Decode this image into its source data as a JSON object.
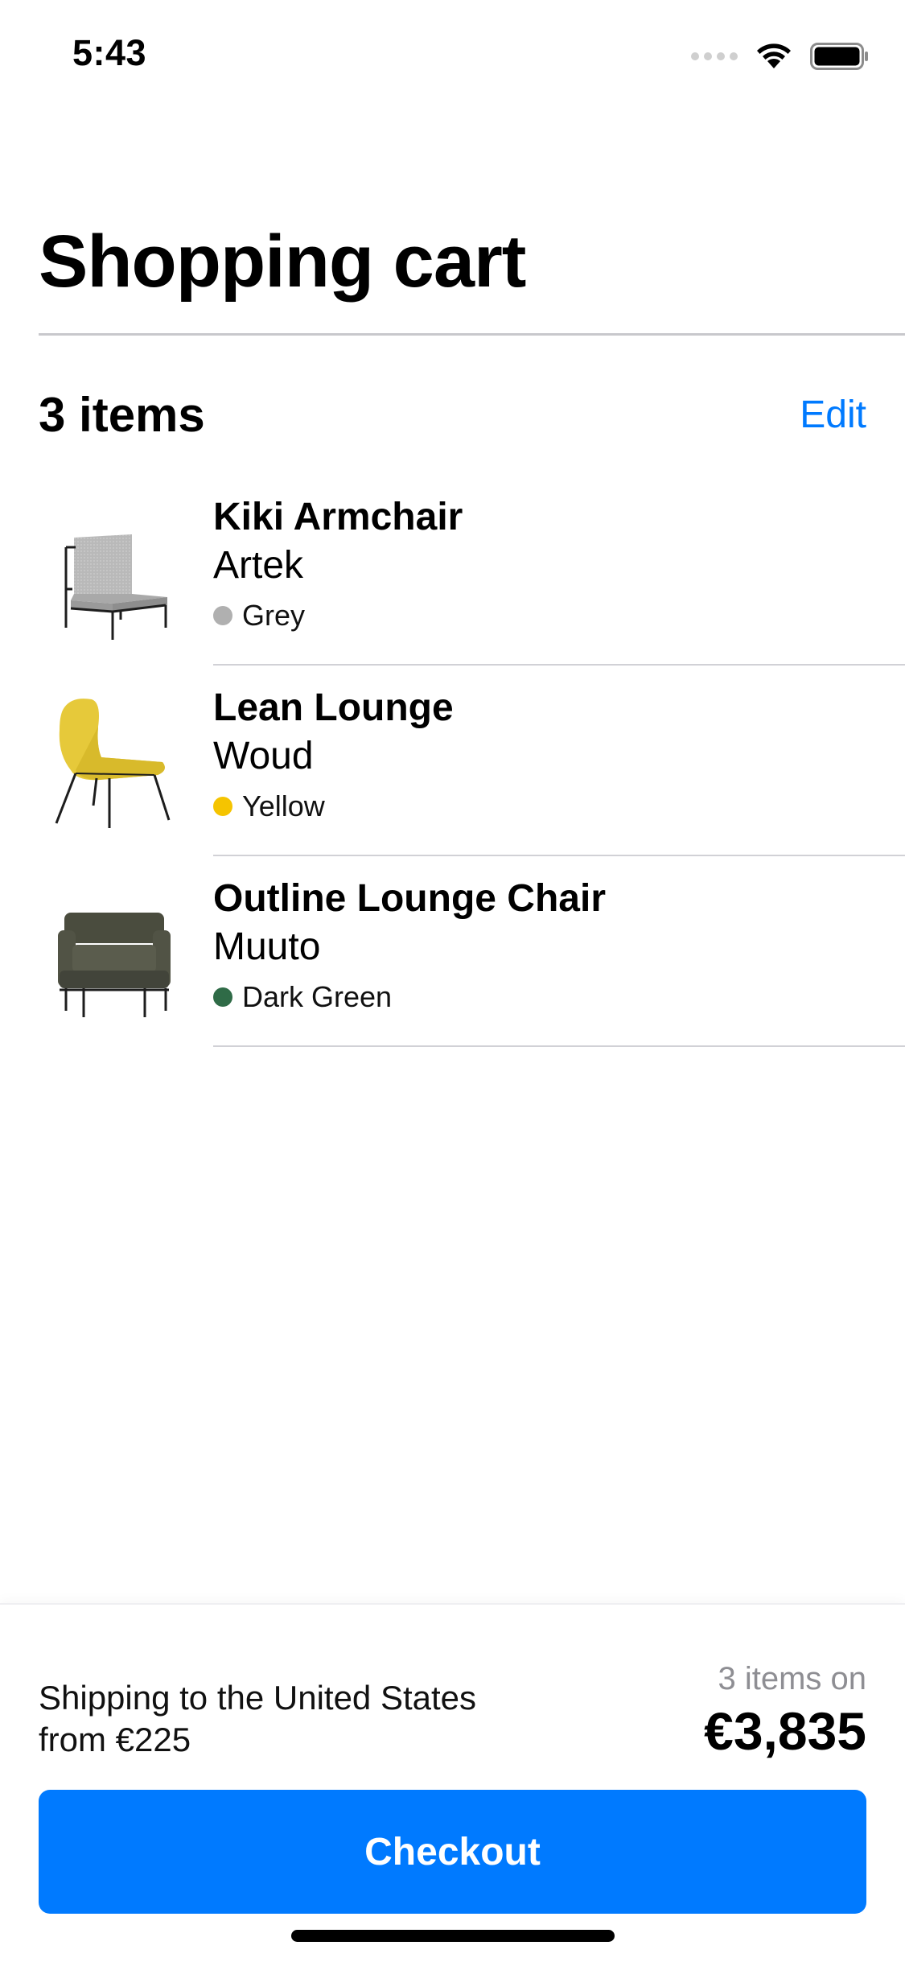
{
  "status_bar": {
    "time": "5:43",
    "icons": [
      "signal-icon",
      "wifi-icon",
      "battery-icon"
    ]
  },
  "header": {
    "title": "Shopping cart"
  },
  "cart": {
    "count_label": "3 items",
    "edit_label": "Edit",
    "items": [
      {
        "name": "Kiki Armchair",
        "brand": "Artek",
        "color_name": "Grey",
        "color_hex": "#b0b0b0",
        "image": "grey-armchair-image"
      },
      {
        "name": "Lean Lounge",
        "brand": "Woud",
        "color_name": "Yellow",
        "color_hex": "#f5c400",
        "image": "yellow-lounge-chair-image"
      },
      {
        "name": "Outline Lounge Chair",
        "brand": "Muuto",
        "color_name": "Dark Green",
        "color_hex": "#2f6b47",
        "image": "dark-green-lounge-chair-image"
      }
    ]
  },
  "footer": {
    "shipping_line1": "Shipping to the United States",
    "shipping_line2": "from €225",
    "total_count": "3 items on",
    "total_price": "€3,835",
    "checkout_label": "Checkout"
  },
  "colors": {
    "accent": "#007aff",
    "divider": "#d1d1d6",
    "secondary_text": "#8e8e93"
  }
}
